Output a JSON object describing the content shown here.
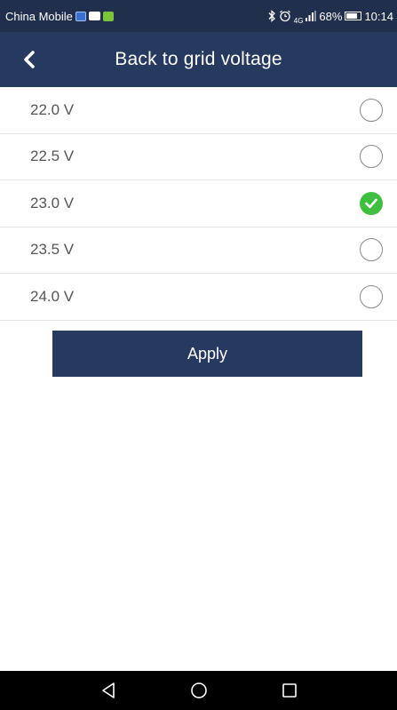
{
  "status_bar": {
    "carrier": "China Mobile",
    "signal_text": "4G",
    "battery_percent": "68%",
    "time": "10:14"
  },
  "header": {
    "title": "Back to grid voltage",
    "back_icon": "chevron-left-icon"
  },
  "options": [
    {
      "label": "22.0 V",
      "selected": false
    },
    {
      "label": "22.5 V",
      "selected": false
    },
    {
      "label": "23.0 V",
      "selected": true
    },
    {
      "label": "23.5 V",
      "selected": false
    },
    {
      "label": "24.0 V",
      "selected": false
    }
  ],
  "apply_label": "Apply",
  "colors": {
    "header_bg": "#263a5f",
    "status_bg": "#1f2f4c",
    "check_green": "#3fbf3f",
    "button_bg": "#263a5f"
  },
  "nav": {
    "back_icon": "triangle-back-icon",
    "home_icon": "circle-home-icon",
    "recents_icon": "square-recents-icon"
  }
}
